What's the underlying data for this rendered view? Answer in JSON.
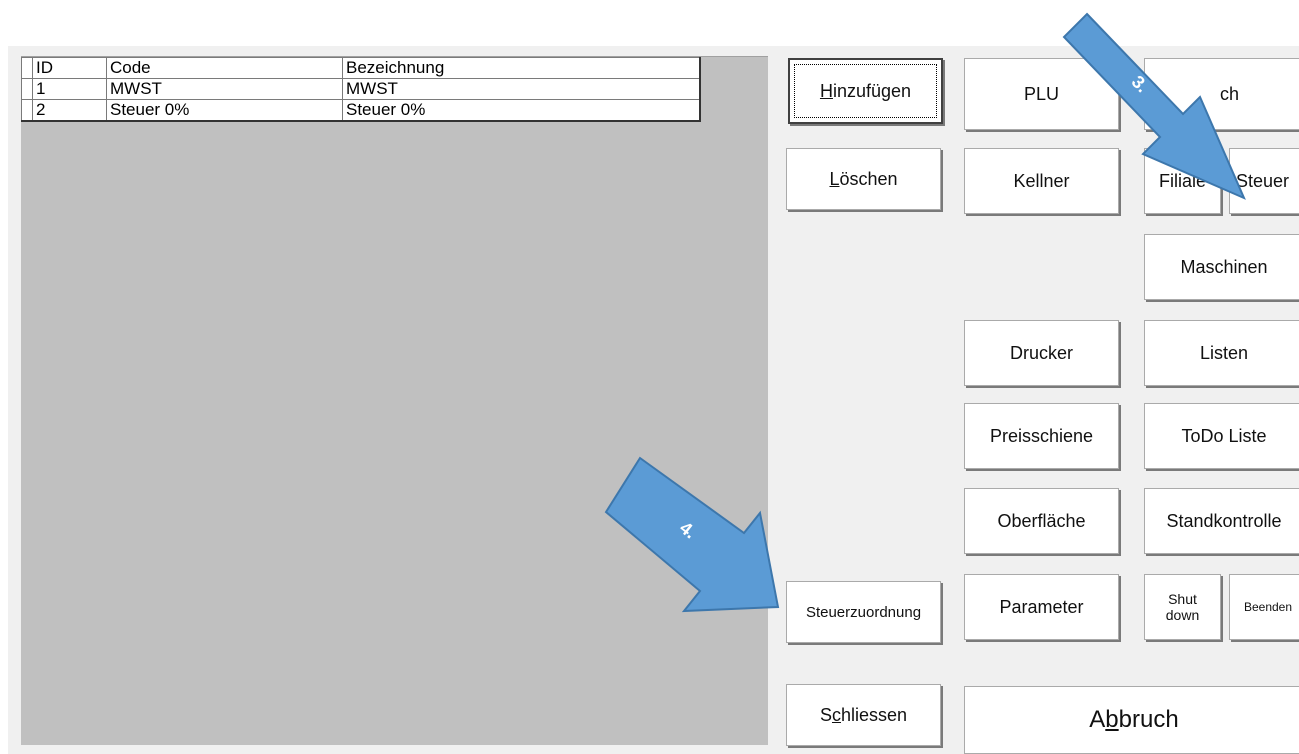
{
  "grid": {
    "headers": [
      "ID",
      "Code",
      "Bezeichnung"
    ],
    "rows": [
      [
        "1",
        "MWST",
        "MWST"
      ],
      [
        "2",
        "Steuer 0%",
        "Steuer 0%"
      ]
    ]
  },
  "buttons": {
    "add_pre": "",
    "add_u": "H",
    "add_post": "inzufügen",
    "delete_pre": "",
    "delete_u": "L",
    "delete_post": "öschen",
    "tax_assignment": "Steuerzuordnung",
    "close_pre": "S",
    "close_u": "c",
    "close_post": "hliessen",
    "plu": "PLU",
    "partial_right": "ch",
    "waiter": "Kellner",
    "branch": "Filiale",
    "tax": "Steuer",
    "machines": "Maschinen",
    "printer": "Drucker",
    "lists": "Listen",
    "price_rail": "Preisschiene",
    "todo": "ToDo Liste",
    "surface": "Oberfläche",
    "stock_control": "Standkontrolle",
    "parameters": "Parameter",
    "shutdown_l1": "Shut",
    "shutdown_l2": "down",
    "quit": "Beenden",
    "cancel_pre": "A",
    "cancel_u": "b",
    "cancel_post": "bruch"
  },
  "annotations": {
    "step3": "3.",
    "step4": "4.",
    "arrow_color": "#5b9bd5"
  }
}
